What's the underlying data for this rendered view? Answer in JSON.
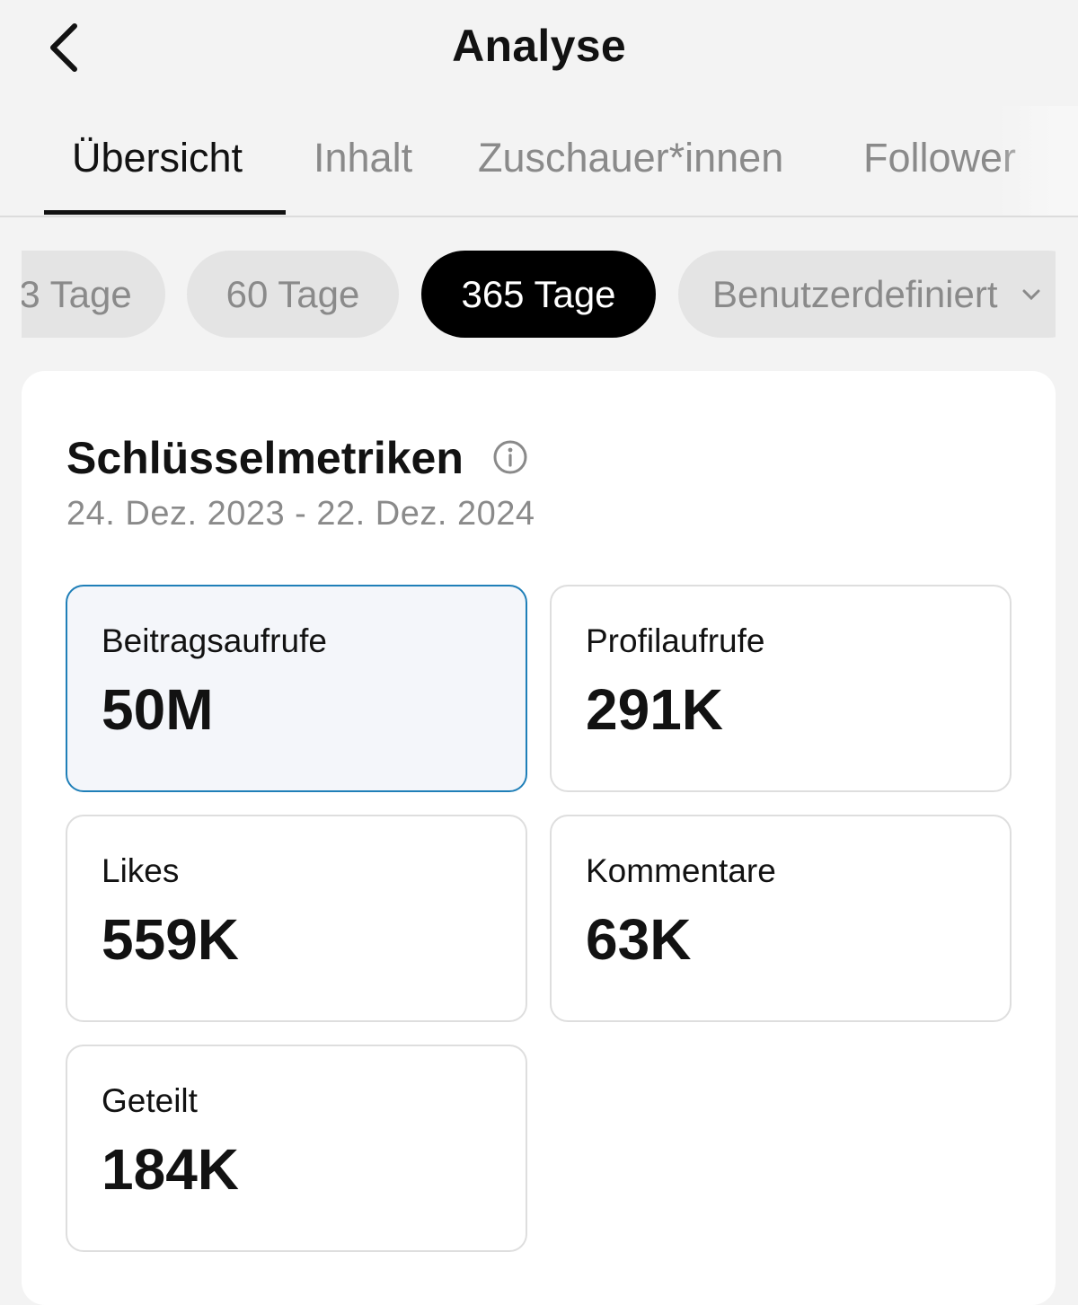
{
  "header": {
    "title": "Analyse",
    "back_icon": "chevron-left-icon"
  },
  "tabs": [
    {
      "label": "Übersicht",
      "active": true
    },
    {
      "label": "Inhalt",
      "active": false
    },
    {
      "label": "Zuschauer*innen",
      "active": false
    },
    {
      "label": "Follower",
      "active": false
    }
  ],
  "date_filters": [
    {
      "label": "3 Tage",
      "active": false
    },
    {
      "label": "60 Tage",
      "active": false
    },
    {
      "label": "365 Tage",
      "active": true
    },
    {
      "label": "Benutzerdefiniert",
      "active": false,
      "icon": "chevron-down-icon"
    }
  ],
  "key_metrics": {
    "title": "Schlüsselmetriken",
    "info_icon": "info-icon",
    "date_range": "24. Dez. 2023 - 22. Dez. 2024",
    "items": [
      {
        "label": "Beitragsaufrufe",
        "value": "50M",
        "selected": true
      },
      {
        "label": "Profilaufrufe",
        "value": "291K",
        "selected": false
      },
      {
        "label": "Likes",
        "value": "559K",
        "selected": false
      },
      {
        "label": "Kommentare",
        "value": "63K",
        "selected": false
      },
      {
        "label": "Geteilt",
        "value": "184K",
        "selected": false
      }
    ]
  },
  "colors": {
    "background": "#f3f3f3",
    "active_chip": "#000000",
    "selected_border": "#1f7fb8",
    "muted_text": "#8a8a8a"
  }
}
